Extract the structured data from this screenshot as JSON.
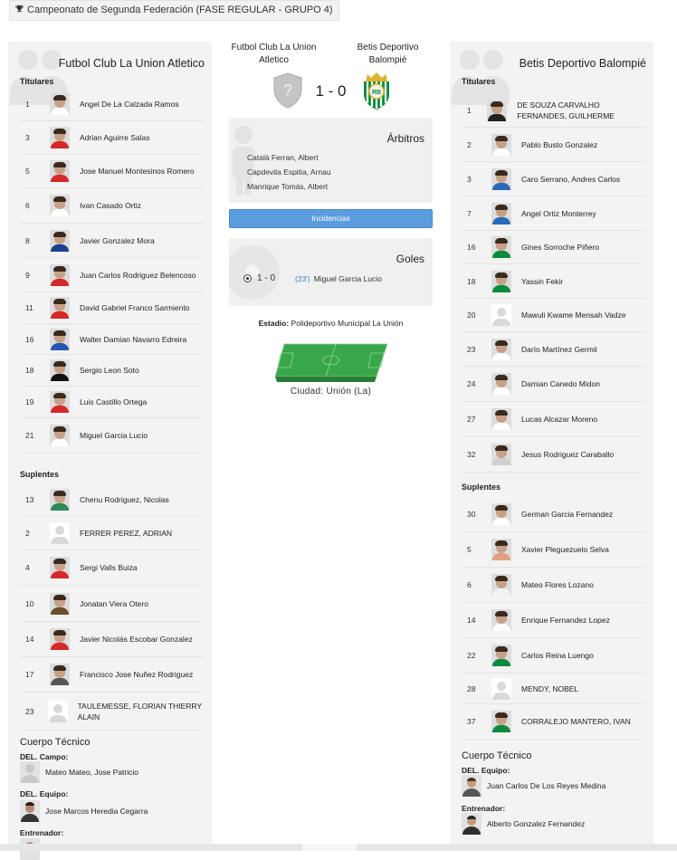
{
  "competition": {
    "title": "Campeonato de Segunda Federación (FASE REGULAR - GRUPO 4)",
    "icon": "trophy-icon"
  },
  "home": {
    "name": "Futbol Club La Union Atletico",
    "starters_label": "Titulares",
    "subs_label": "Suplentes",
    "starters": [
      {
        "num": "1",
        "name": "Angel De La Calzada Ramos"
      },
      {
        "num": "3",
        "name": "Adrian Aguirre Salas"
      },
      {
        "num": "5",
        "name": "Jose Manuel Montesinos Romero"
      },
      {
        "num": "6",
        "name": "Ivan Casado Ortiz"
      },
      {
        "num": "8",
        "name": "Javier Gonzalez Mora"
      },
      {
        "num": "9",
        "name": "Juan Carlos Rodriguez Belencoso"
      },
      {
        "num": "11",
        "name": "David Gabriel Franco Sarmiento"
      },
      {
        "num": "16",
        "name": "Walter Damian Navarro Edreira"
      },
      {
        "num": "18",
        "name": "Sergio Leon Soto"
      },
      {
        "num": "19",
        "name": "Luis Castillo Ortega"
      },
      {
        "num": "21",
        "name": "Miguel Garcia Lucio"
      }
    ],
    "subs": [
      {
        "num": "13",
        "name": "Chenu Rodriguez, Nicolas"
      },
      {
        "num": "2",
        "name": "FERRER PEREZ, ADRIAN"
      },
      {
        "num": "4",
        "name": "Sergi Valls Buiza"
      },
      {
        "num": "10",
        "name": "Jonatan Viera Otero"
      },
      {
        "num": "14",
        "name": "Javier Nicolás Escobar Gonzalez"
      },
      {
        "num": "17",
        "name": "Francisco Jose Nuñez Rodriguez"
      },
      {
        "num": "23",
        "name": "TAULEMESSE, FLORIAN THIERRY ALAIN"
      }
    ],
    "staff_title": "Cuerpo Técnico",
    "staff": [
      {
        "role": "DEL. Campo:",
        "name": "Mateo Mateo, Jose Patricio"
      },
      {
        "role": "DEL. Equipo:",
        "name": "Jose Marcos Heredia Cegarra"
      },
      {
        "role": "Entrenador:",
        "name": ""
      }
    ]
  },
  "away": {
    "name": "Betis Deportivo Balompié",
    "starters_label": "Titulares",
    "subs_label": "Suplentes",
    "starters": [
      {
        "num": "1",
        "name": "DE SOUZA CARVALHO FERNANDES, GUILHERME"
      },
      {
        "num": "2",
        "name": "Pablo Busto Gonzalez"
      },
      {
        "num": "3",
        "name": "Caro Serrano, Andres Carlos"
      },
      {
        "num": "7",
        "name": "Angel Ortiz Monterrey"
      },
      {
        "num": "16",
        "name": "Gines Sorroche Piñero"
      },
      {
        "num": "18",
        "name": "Yassin Fekir"
      },
      {
        "num": "20",
        "name": "Mawuli Kwame Mensah Vadze"
      },
      {
        "num": "23",
        "name": "Darío Martínez Germil"
      },
      {
        "num": "24",
        "name": "Damian Canedo Midon"
      },
      {
        "num": "27",
        "name": "Lucas Alcazar Moreno"
      },
      {
        "num": "32",
        "name": "Jesus Rodriguez Caraballo"
      }
    ],
    "subs": [
      {
        "num": "30",
        "name": "German Garcia Fernandez"
      },
      {
        "num": "5",
        "name": "Xavier Pleguezuelo Selva"
      },
      {
        "num": "6",
        "name": "Mateo Flores Lozano"
      },
      {
        "num": "14",
        "name": "Enrique Fernandez Lopez"
      },
      {
        "num": "22",
        "name": "Carlos Reina Luengo"
      },
      {
        "num": "28",
        "name": "MENDY, NOBEL"
      },
      {
        "num": "37",
        "name": "CORRALEJO MANTERO, IVAN"
      }
    ],
    "staff_title": "Cuerpo Técnico",
    "staff": [
      {
        "role": "DEL. Equipo:",
        "name": "Juan Carlos De Los Reyes Medina"
      },
      {
        "role": "Entrenador:",
        "name": "Alberto Gonzalez Fernandez"
      }
    ]
  },
  "match": {
    "home_name": "Futbol Club La Union Atletico",
    "away_name": "Betis Deportivo Balompié",
    "score": "1 - 0",
    "referees_title": "Árbitros",
    "referees": [
      "Català Ferran, Albert",
      "Capdevila Espitia, Arnau",
      "Manrique Tomás, Albert"
    ],
    "incidents_label": "Incidencias",
    "goals_title": "Goles",
    "goals": [
      {
        "score": "1 - 0",
        "minute": "(23')",
        "scorer": "Miguel Garcia Lucio"
      }
    ],
    "stadium_label": "Estadio:",
    "stadium": "Polideportivo Municipal La Unión",
    "city": "Ciudad: Unión (La)"
  },
  "colors": {
    "incidents_button": "#5b9ddf",
    "panel_bg": "#f3f3f3",
    "goal_minute": "#3b7dc4",
    "pitch": "#3aa64a"
  }
}
